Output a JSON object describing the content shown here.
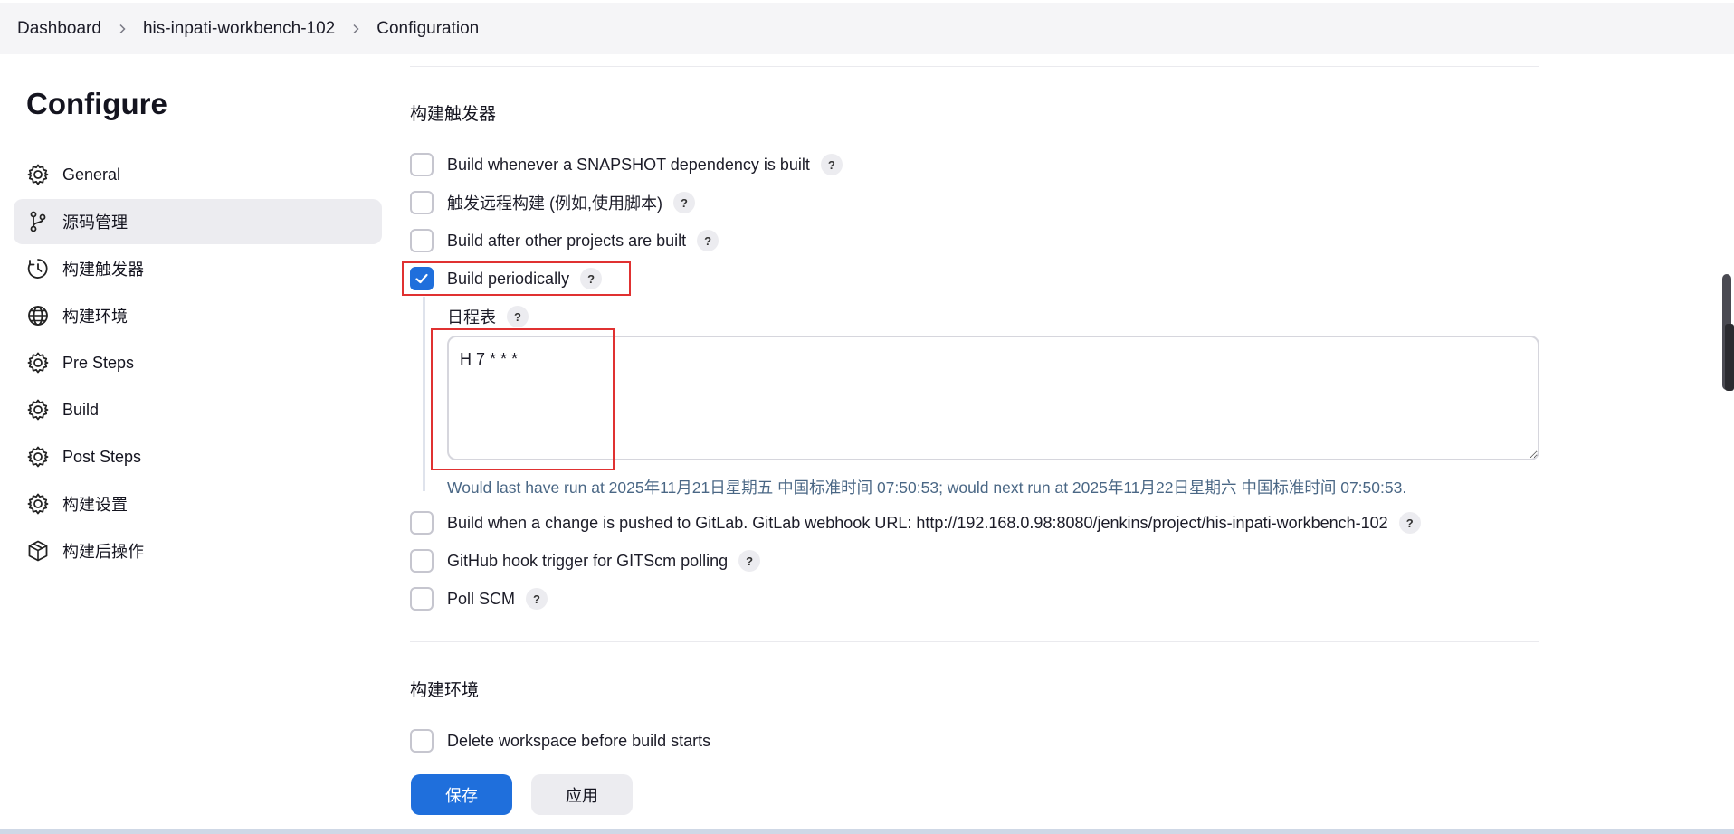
{
  "breadcrumb": {
    "items": [
      "Dashboard",
      "his-inpati-workbench-102",
      "Configuration"
    ]
  },
  "sidebar": {
    "title": "Configure",
    "items": [
      {
        "label": "General",
        "icon": "gear-icon"
      },
      {
        "label": "源码管理",
        "icon": "branch-icon"
      },
      {
        "label": "构建触发器",
        "icon": "clock-icon"
      },
      {
        "label": "构建环境",
        "icon": "globe-icon"
      },
      {
        "label": "Pre Steps",
        "icon": "gear-icon"
      },
      {
        "label": "Build",
        "icon": "gear-icon"
      },
      {
        "label": "Post Steps",
        "icon": "gear-icon"
      },
      {
        "label": "构建设置",
        "icon": "gear-icon"
      },
      {
        "label": "构建后操作",
        "icon": "package-icon"
      }
    ],
    "active_index": 1
  },
  "triggers": {
    "section_title": "构建触发器",
    "options": [
      {
        "label": "Build whenever a SNAPSHOT dependency is built",
        "checked": false
      },
      {
        "label": "触发远程构建 (例如,使用脚本)",
        "checked": false
      },
      {
        "label": "Build after other projects are built",
        "checked": false
      },
      {
        "label": "Build periodically",
        "checked": true
      },
      {
        "label": "Build when a change is pushed to GitLab. GitLab webhook URL: http://192.168.0.98:8080/jenkins/project/his-inpati-workbench-102",
        "checked": false
      },
      {
        "label": "GitHub hook trigger for GITScm polling",
        "checked": false
      },
      {
        "label": "Poll SCM",
        "checked": false
      }
    ],
    "schedule": {
      "label": "日程表",
      "value": "H 7 * * *",
      "hint": "Would last have run at 2025年11月21日星期五 中国标准时间 07:50:53; would next run at 2025年11月22日星期六 中国标准时间 07:50:53."
    },
    "help_glyph": "?"
  },
  "environment": {
    "section_title": "构建环境",
    "options": [
      {
        "label": "Delete workspace before build starts",
        "checked": false
      }
    ]
  },
  "actions": {
    "save_label": "保存",
    "apply_label": "应用"
  },
  "colors": {
    "accent": "#1f6fdc",
    "highlight": "#e03131"
  }
}
